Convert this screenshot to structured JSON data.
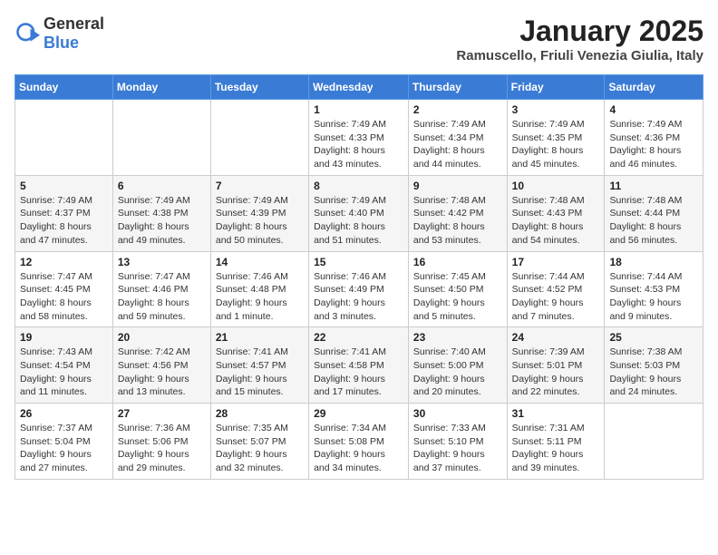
{
  "header": {
    "logo_general": "General",
    "logo_blue": "Blue",
    "title": "January 2025",
    "subtitle": "Ramuscello, Friuli Venezia Giulia, Italy"
  },
  "days_of_week": [
    "Sunday",
    "Monday",
    "Tuesday",
    "Wednesday",
    "Thursday",
    "Friday",
    "Saturday"
  ],
  "weeks": [
    {
      "days": [
        {
          "num": "",
          "info": ""
        },
        {
          "num": "",
          "info": ""
        },
        {
          "num": "",
          "info": ""
        },
        {
          "num": "1",
          "info": "Sunrise: 7:49 AM\nSunset: 4:33 PM\nDaylight: 8 hours and 43 minutes."
        },
        {
          "num": "2",
          "info": "Sunrise: 7:49 AM\nSunset: 4:34 PM\nDaylight: 8 hours and 44 minutes."
        },
        {
          "num": "3",
          "info": "Sunrise: 7:49 AM\nSunset: 4:35 PM\nDaylight: 8 hours and 45 minutes."
        },
        {
          "num": "4",
          "info": "Sunrise: 7:49 AM\nSunset: 4:36 PM\nDaylight: 8 hours and 46 minutes."
        }
      ]
    },
    {
      "days": [
        {
          "num": "5",
          "info": "Sunrise: 7:49 AM\nSunset: 4:37 PM\nDaylight: 8 hours and 47 minutes."
        },
        {
          "num": "6",
          "info": "Sunrise: 7:49 AM\nSunset: 4:38 PM\nDaylight: 8 hours and 49 minutes."
        },
        {
          "num": "7",
          "info": "Sunrise: 7:49 AM\nSunset: 4:39 PM\nDaylight: 8 hours and 50 minutes."
        },
        {
          "num": "8",
          "info": "Sunrise: 7:49 AM\nSunset: 4:40 PM\nDaylight: 8 hours and 51 minutes."
        },
        {
          "num": "9",
          "info": "Sunrise: 7:48 AM\nSunset: 4:42 PM\nDaylight: 8 hours and 53 minutes."
        },
        {
          "num": "10",
          "info": "Sunrise: 7:48 AM\nSunset: 4:43 PM\nDaylight: 8 hours and 54 minutes."
        },
        {
          "num": "11",
          "info": "Sunrise: 7:48 AM\nSunset: 4:44 PM\nDaylight: 8 hours and 56 minutes."
        }
      ]
    },
    {
      "days": [
        {
          "num": "12",
          "info": "Sunrise: 7:47 AM\nSunset: 4:45 PM\nDaylight: 8 hours and 58 minutes."
        },
        {
          "num": "13",
          "info": "Sunrise: 7:47 AM\nSunset: 4:46 PM\nDaylight: 8 hours and 59 minutes."
        },
        {
          "num": "14",
          "info": "Sunrise: 7:46 AM\nSunset: 4:48 PM\nDaylight: 9 hours and 1 minute."
        },
        {
          "num": "15",
          "info": "Sunrise: 7:46 AM\nSunset: 4:49 PM\nDaylight: 9 hours and 3 minutes."
        },
        {
          "num": "16",
          "info": "Sunrise: 7:45 AM\nSunset: 4:50 PM\nDaylight: 9 hours and 5 minutes."
        },
        {
          "num": "17",
          "info": "Sunrise: 7:44 AM\nSunset: 4:52 PM\nDaylight: 9 hours and 7 minutes."
        },
        {
          "num": "18",
          "info": "Sunrise: 7:44 AM\nSunset: 4:53 PM\nDaylight: 9 hours and 9 minutes."
        }
      ]
    },
    {
      "days": [
        {
          "num": "19",
          "info": "Sunrise: 7:43 AM\nSunset: 4:54 PM\nDaylight: 9 hours and 11 minutes."
        },
        {
          "num": "20",
          "info": "Sunrise: 7:42 AM\nSunset: 4:56 PM\nDaylight: 9 hours and 13 minutes."
        },
        {
          "num": "21",
          "info": "Sunrise: 7:41 AM\nSunset: 4:57 PM\nDaylight: 9 hours and 15 minutes."
        },
        {
          "num": "22",
          "info": "Sunrise: 7:41 AM\nSunset: 4:58 PM\nDaylight: 9 hours and 17 minutes."
        },
        {
          "num": "23",
          "info": "Sunrise: 7:40 AM\nSunset: 5:00 PM\nDaylight: 9 hours and 20 minutes."
        },
        {
          "num": "24",
          "info": "Sunrise: 7:39 AM\nSunset: 5:01 PM\nDaylight: 9 hours and 22 minutes."
        },
        {
          "num": "25",
          "info": "Sunrise: 7:38 AM\nSunset: 5:03 PM\nDaylight: 9 hours and 24 minutes."
        }
      ]
    },
    {
      "days": [
        {
          "num": "26",
          "info": "Sunrise: 7:37 AM\nSunset: 5:04 PM\nDaylight: 9 hours and 27 minutes."
        },
        {
          "num": "27",
          "info": "Sunrise: 7:36 AM\nSunset: 5:06 PM\nDaylight: 9 hours and 29 minutes."
        },
        {
          "num": "28",
          "info": "Sunrise: 7:35 AM\nSunset: 5:07 PM\nDaylight: 9 hours and 32 minutes."
        },
        {
          "num": "29",
          "info": "Sunrise: 7:34 AM\nSunset: 5:08 PM\nDaylight: 9 hours and 34 minutes."
        },
        {
          "num": "30",
          "info": "Sunrise: 7:33 AM\nSunset: 5:10 PM\nDaylight: 9 hours and 37 minutes."
        },
        {
          "num": "31",
          "info": "Sunrise: 7:31 AM\nSunset: 5:11 PM\nDaylight: 9 hours and 39 minutes."
        },
        {
          "num": "",
          "info": ""
        }
      ]
    }
  ]
}
